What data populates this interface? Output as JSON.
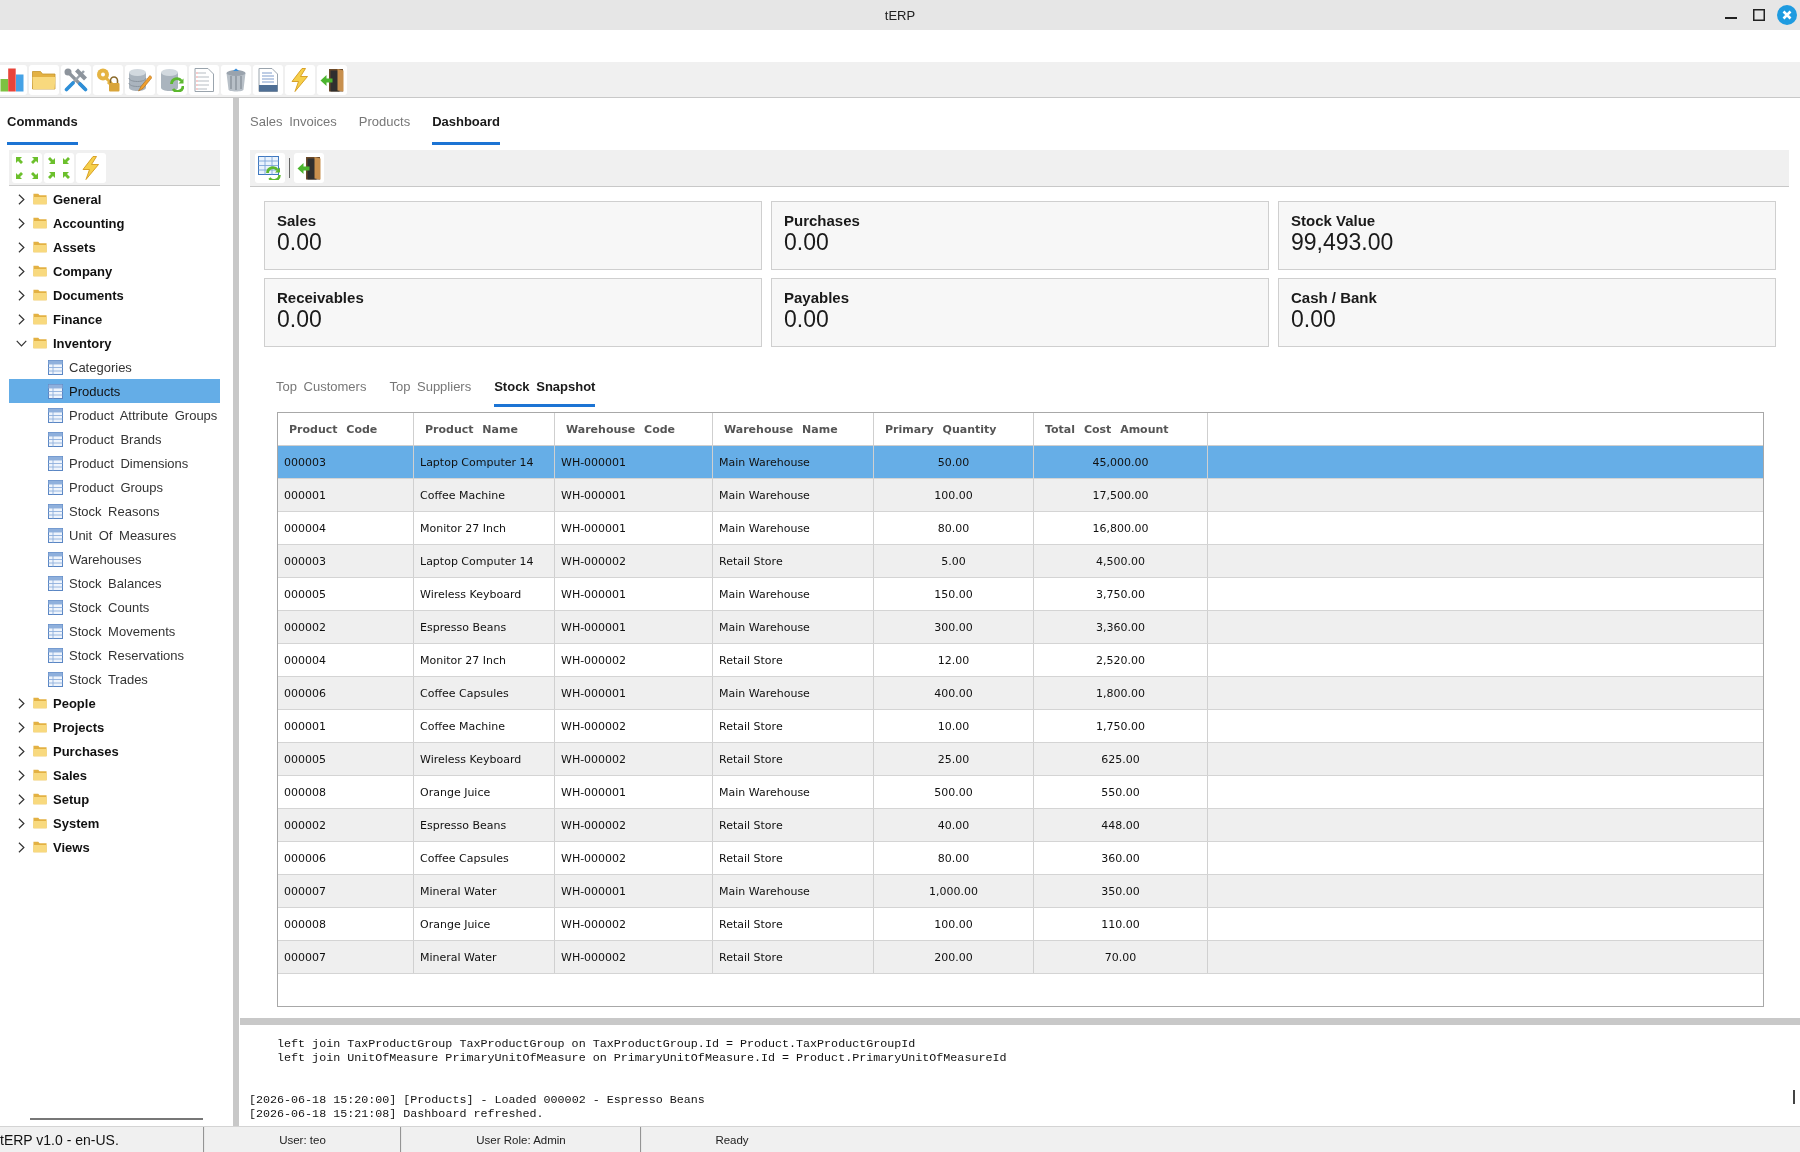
{
  "window": {
    "title": "tERP"
  },
  "sidebar": {
    "tabs": [
      {
        "label": "Commands",
        "selected": true
      }
    ],
    "tree": [
      {
        "label": "General",
        "expanded": false,
        "selected": false
      },
      {
        "label": "Accounting",
        "expanded": false,
        "selected": false
      },
      {
        "label": "Assets",
        "expanded": false,
        "selected": false
      },
      {
        "label": "Company",
        "expanded": false,
        "selected": false
      },
      {
        "label": "Documents",
        "expanded": false,
        "selected": false
      },
      {
        "label": "Finance",
        "expanded": false,
        "selected": false
      },
      {
        "label": "Inventory",
        "expanded": true,
        "selected": false,
        "children": [
          {
            "label": "Categories",
            "selected": false
          },
          {
            "label": "Products",
            "selected": true
          },
          {
            "label": "Product Attribute Groups",
            "selected": false
          },
          {
            "label": "Product Brands",
            "selected": false
          },
          {
            "label": "Product Dimensions",
            "selected": false
          },
          {
            "label": "Product Groups",
            "selected": false
          },
          {
            "label": "Stock Reasons",
            "selected": false
          },
          {
            "label": "Unit Of Measures",
            "selected": false
          },
          {
            "label": "Warehouses",
            "selected": false
          },
          {
            "label": "Stock Balances",
            "selected": false
          },
          {
            "label": "Stock Counts",
            "selected": false
          },
          {
            "label": "Stock Movements",
            "selected": false
          },
          {
            "label": "Stock Reservations",
            "selected": false
          },
          {
            "label": "Stock Trades",
            "selected": false
          }
        ]
      },
      {
        "label": "People",
        "expanded": false,
        "selected": false
      },
      {
        "label": "Projects",
        "expanded": false,
        "selected": false
      },
      {
        "label": "Purchases",
        "expanded": false,
        "selected": false
      },
      {
        "label": "Sales",
        "expanded": false,
        "selected": false
      },
      {
        "label": "Setup",
        "expanded": false,
        "selected": false
      },
      {
        "label": "System",
        "expanded": false,
        "selected": false
      },
      {
        "label": "Views",
        "expanded": false,
        "selected": false
      }
    ]
  },
  "main_tabs": [
    {
      "label": "Sales Invoices",
      "selected": false
    },
    {
      "label": "Products",
      "selected": false
    },
    {
      "label": "Dashboard",
      "selected": true
    }
  ],
  "dashboard": {
    "cards": [
      {
        "label": "Sales",
        "value": "0.00"
      },
      {
        "label": "Purchases",
        "value": "0.00"
      },
      {
        "label": "Stock Value",
        "value": "99,493.00"
      },
      {
        "label": "Receivables",
        "value": "0.00"
      },
      {
        "label": "Payables",
        "value": "0.00"
      },
      {
        "label": "Cash / Bank",
        "value": "0.00"
      }
    ],
    "tabs": [
      {
        "label": "Top Customers",
        "selected": false
      },
      {
        "label": "Top Suppliers",
        "selected": false
      },
      {
        "label": "Stock Snapshot",
        "selected": true
      }
    ],
    "table": {
      "columns": [
        "Product Code",
        "Product Name",
        "Warehouse Code",
        "Warehouse Name",
        "Primary Quantity",
        "Total Cost Amount"
      ],
      "rows": [
        {
          "cells": [
            "000003",
            "Laptop Computer 14",
            "WH-000001",
            "Main Warehouse",
            "50.00",
            "45,000.00"
          ],
          "selected": true
        },
        {
          "cells": [
            "000001",
            "Coffee Machine",
            "WH-000001",
            "Main Warehouse",
            "100.00",
            "17,500.00"
          ],
          "selected": false
        },
        {
          "cells": [
            "000004",
            "Monitor 27 Inch",
            "WH-000001",
            "Main Warehouse",
            "80.00",
            "16,800.00"
          ],
          "selected": false
        },
        {
          "cells": [
            "000003",
            "Laptop Computer 14",
            "WH-000002",
            "Retail Store",
            "5.00",
            "4,500.00"
          ],
          "selected": false
        },
        {
          "cells": [
            "000005",
            "Wireless Keyboard",
            "WH-000001",
            "Main Warehouse",
            "150.00",
            "3,750.00"
          ],
          "selected": false
        },
        {
          "cells": [
            "000002",
            "Espresso Beans",
            "WH-000001",
            "Main Warehouse",
            "300.00",
            "3,360.00"
          ],
          "selected": false
        },
        {
          "cells": [
            "000004",
            "Monitor 27 Inch",
            "WH-000002",
            "Retail Store",
            "12.00",
            "2,520.00"
          ],
          "selected": false
        },
        {
          "cells": [
            "000006",
            "Coffee Capsules",
            "WH-000001",
            "Main Warehouse",
            "400.00",
            "1,800.00"
          ],
          "selected": false
        },
        {
          "cells": [
            "000001",
            "Coffee Machine",
            "WH-000002",
            "Retail Store",
            "10.00",
            "1,750.00"
          ],
          "selected": false
        },
        {
          "cells": [
            "000005",
            "Wireless Keyboard",
            "WH-000002",
            "Retail Store",
            "25.00",
            "625.00"
          ],
          "selected": false
        },
        {
          "cells": [
            "000008",
            "Orange Juice",
            "WH-000001",
            "Main Warehouse",
            "500.00",
            "550.00"
          ],
          "selected": false
        },
        {
          "cells": [
            "000002",
            "Espresso Beans",
            "WH-000002",
            "Retail Store",
            "40.00",
            "448.00"
          ],
          "selected": false
        },
        {
          "cells": [
            "000006",
            "Coffee Capsules",
            "WH-000002",
            "Retail Store",
            "80.00",
            "360.00"
          ],
          "selected": false
        },
        {
          "cells": [
            "000007",
            "Mineral Water",
            "WH-000001",
            "Main Warehouse",
            "1,000.00",
            "350.00"
          ],
          "selected": false
        },
        {
          "cells": [
            "000008",
            "Orange Juice",
            "WH-000002",
            "Retail Store",
            "100.00",
            "110.00"
          ],
          "selected": false
        },
        {
          "cells": [
            "000007",
            "Mineral Water",
            "WH-000002",
            "Retail Store",
            "200.00",
            "70.00"
          ],
          "selected": false
        }
      ]
    }
  },
  "log": {
    "query_lines": [
      "left join TaxProductGroup TaxProductGroup on TaxProductGroup.Id = Product.TaxProductGroupId",
      "left join UnitOfMeasure PrimaryUnitOfMeasure on PrimaryUnitOfMeasure.Id = Product.PrimaryUnitOfMeasureId"
    ],
    "messages": [
      "[2026-06-18 15:20:00] [Products] - Loaded 000002 - Espresso Beans",
      "[2026-06-18 15:21:08] Dashboard refreshed."
    ]
  },
  "status_bar": {
    "version": "tERP v1.0 - en-US.",
    "user": "User: teo",
    "role": "User Role: Admin",
    "status": "Ready"
  }
}
